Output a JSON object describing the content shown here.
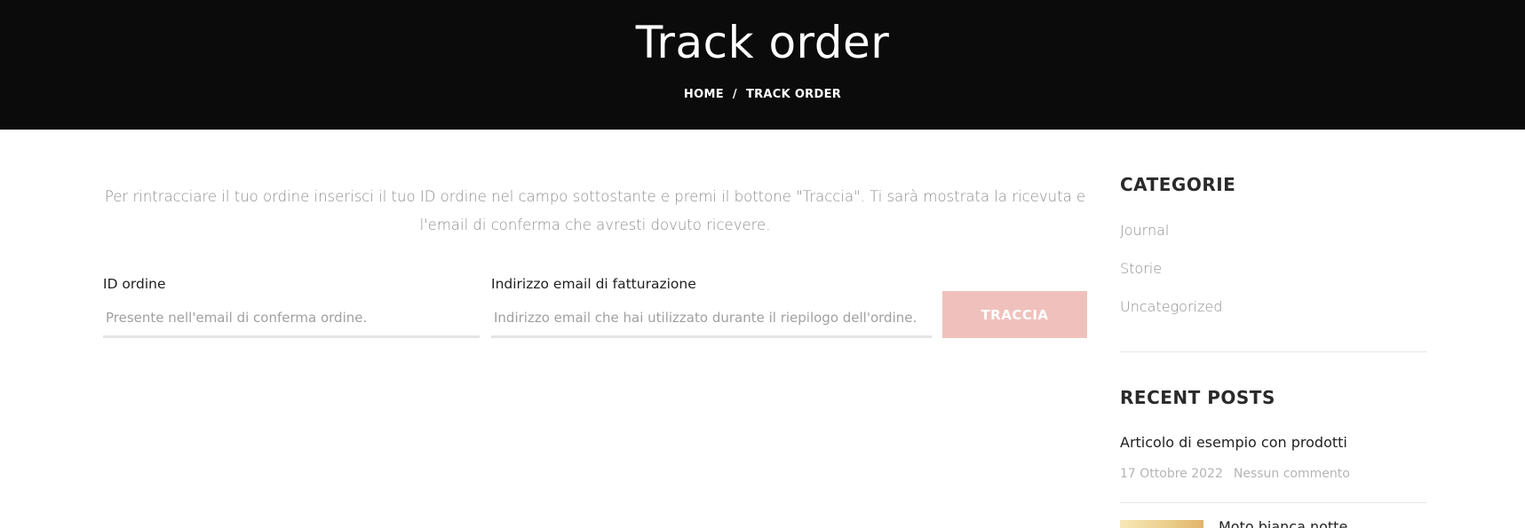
{
  "header": {
    "title": "Track order",
    "breadcrumb": {
      "home": "HOME",
      "separator": "/",
      "current": "TRACK ORDER"
    }
  },
  "main": {
    "intro": "Per rintracciare il tuo ordine inserisci il tuo ID ordine nel campo sottostante e premi il bottone \"Traccia\". Ti sarà mostrata la ricevuta e l'email di conferma che avresti dovuto ricevere.",
    "order_id": {
      "label": "ID ordine",
      "placeholder": "Presente nell'email di conferma ordine.",
      "value": ""
    },
    "email": {
      "label": "Indirizzo email di fatturazione",
      "placeholder": "Indirizzo email che hai utilizzato durante il riepilogo dell'ordine.",
      "value": ""
    },
    "submit_label": "TRACCIA"
  },
  "sidebar": {
    "categories_title": "CATEGORIE",
    "categories": [
      {
        "label": "Journal"
      },
      {
        "label": "Storie"
      },
      {
        "label": "Uncategorized"
      }
    ],
    "recent_title": "RECENT POSTS",
    "posts": [
      {
        "title": "Articolo di esempio con prodotti",
        "date": "17 Ottobre 2022",
        "comments": "Nessun commento"
      },
      {
        "title": "Moto bianca notte"
      }
    ]
  },
  "colors": {
    "hero_bg": "#0b0b0b",
    "button_bg": "#f0c1bc",
    "muted_text": "#8e8e8e"
  }
}
